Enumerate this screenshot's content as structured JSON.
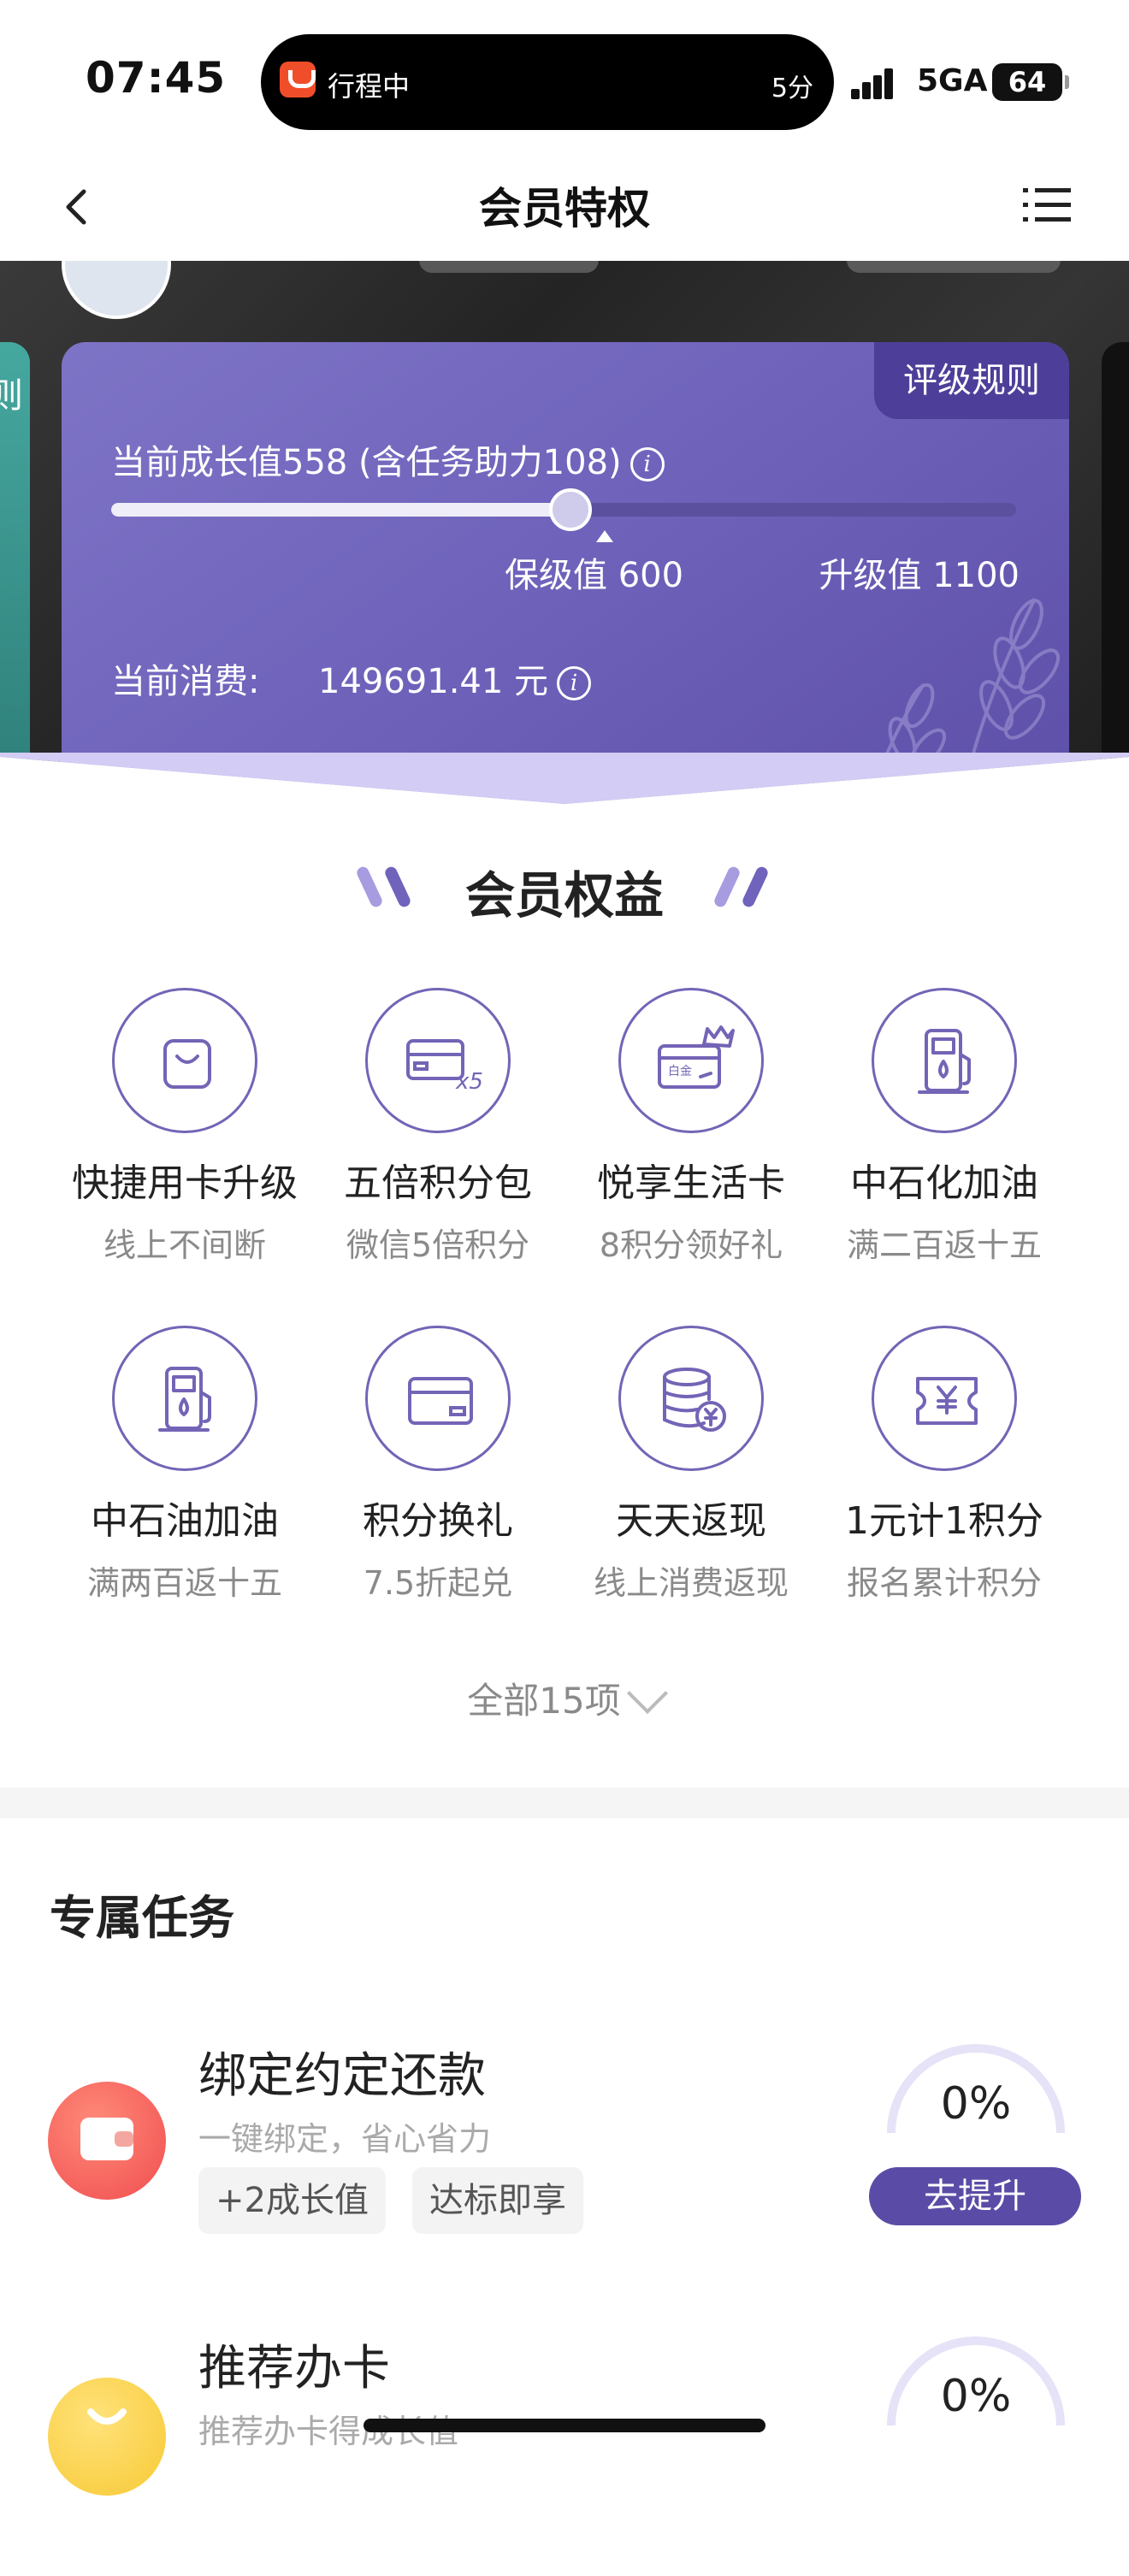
{
  "status_bar": {
    "time": "07:45",
    "activity_label": "行程中",
    "activity_time": "5分",
    "network": "5GA",
    "battery": "64"
  },
  "nav": {
    "title": "会员特权"
  },
  "level_card": {
    "rules_label": "评级规则",
    "growth_text": "当前成长值558 (含任务助力108)",
    "growth_value": 558,
    "keep_level_text": "保级值 600",
    "keep_level_value": 600,
    "upgrade_text": "升级值 1100",
    "upgrade_value": 1100,
    "spend_label": "当前消费:",
    "spend_value": "149691.41 元"
  },
  "benefits": {
    "title": "会员权益",
    "items": [
      {
        "name": "快捷用卡升级",
        "sub": "线上不间断",
        "icon": "shopping-bag-icon"
      },
      {
        "name": "五倍积分包",
        "sub": "微信5倍积分",
        "icon": "card-x5-icon"
      },
      {
        "name": "悦享生活卡",
        "sub": "8积分领好礼",
        "icon": "platinum-card-icon"
      },
      {
        "name": "中石化加油",
        "sub": "满二百返十五",
        "icon": "fuel-pump-icon"
      },
      {
        "name": "中石油加油",
        "sub": "满两百返十五",
        "icon": "fuel-pump-icon"
      },
      {
        "name": "积分换礼",
        "sub": "7.5折起兑",
        "icon": "credit-card-icon"
      },
      {
        "name": "天天返现",
        "sub": "线上消费返现",
        "icon": "coin-stack-icon"
      },
      {
        "name": "1元计1积分",
        "sub": "报名累计积分",
        "icon": "yuan-ticket-icon"
      }
    ],
    "expand_label": "全部15项"
  },
  "tasks": {
    "title": "专属任务",
    "items": [
      {
        "title": "绑定约定还款",
        "desc": "一键绑定，省心省力",
        "tags": [
          "+2成长值",
          "达标即享"
        ],
        "percent": "0%",
        "button": "去提升",
        "icon": "wallet-icon"
      },
      {
        "title": "推荐办卡",
        "desc": "推荐办卡得成长值",
        "percent": "0%",
        "icon": "gift-bag-icon"
      }
    ]
  },
  "colors": {
    "accent": "#5a4ca6",
    "card_purple": "#6f63bb",
    "icon_stroke": "#7464b6"
  }
}
